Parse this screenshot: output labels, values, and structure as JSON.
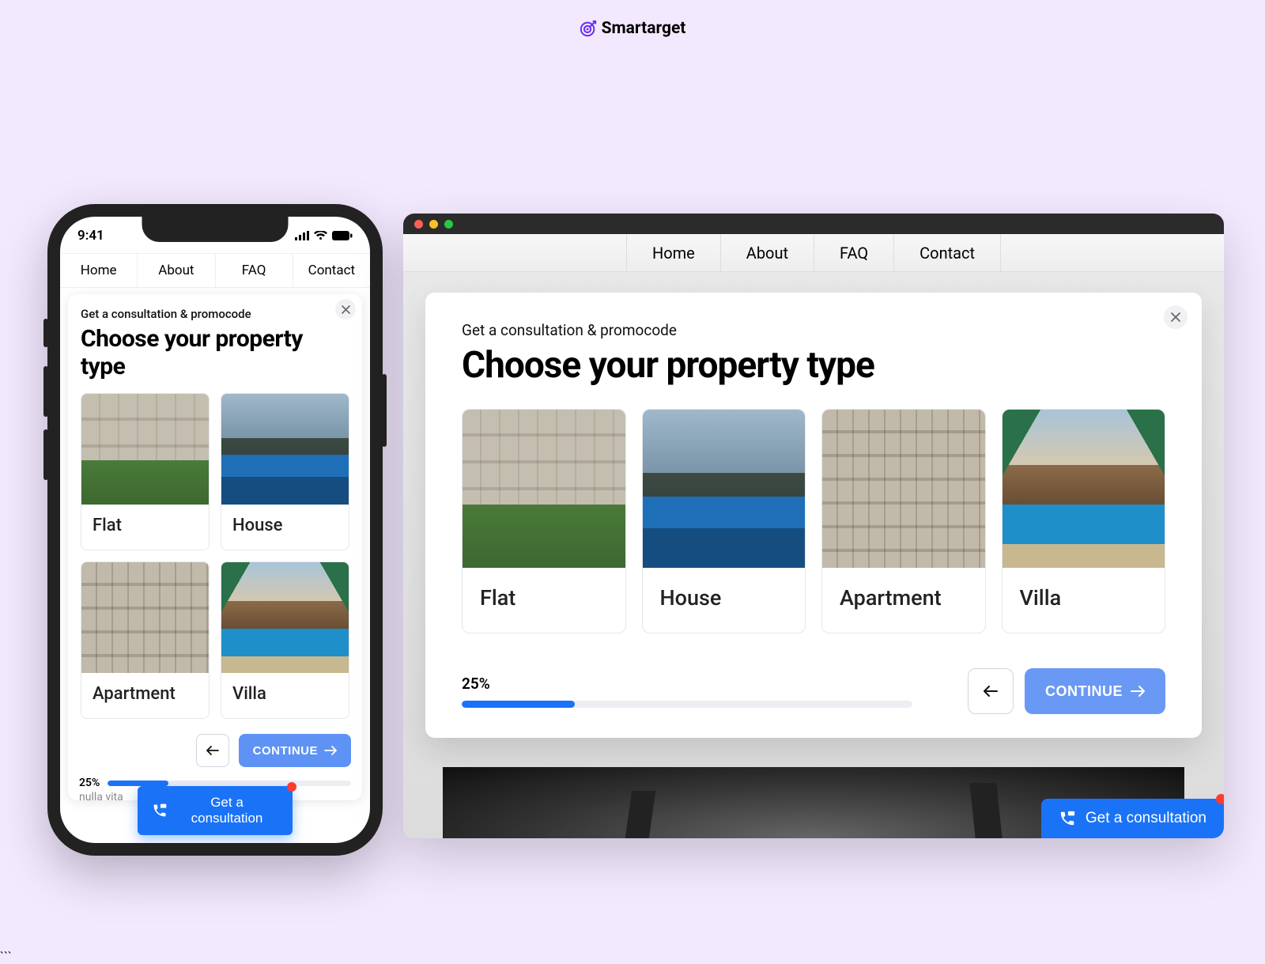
{
  "brand": {
    "name": "Smartarget"
  },
  "nav": {
    "items": [
      "Home",
      "About",
      "FAQ",
      "Contact"
    ]
  },
  "phone": {
    "time": "9:41",
    "hint_text": "nulla vita"
  },
  "modal": {
    "eyebrow": "Get a consultation & promocode",
    "title": "Choose your property type",
    "options": [
      {
        "label": "Flat"
      },
      {
        "label": "House"
      },
      {
        "label": "Apartment"
      },
      {
        "label": "Villa"
      }
    ],
    "options_mobile": [
      {
        "label": "Flat"
      },
      {
        "label": "House"
      },
      {
        "label": "Apartment"
      },
      {
        "label": "Villa"
      }
    ],
    "progress": {
      "percent_label": "25%",
      "percent": 25
    },
    "continue_label": "CONTINUE"
  },
  "cta": {
    "label": "Get a consultation"
  }
}
